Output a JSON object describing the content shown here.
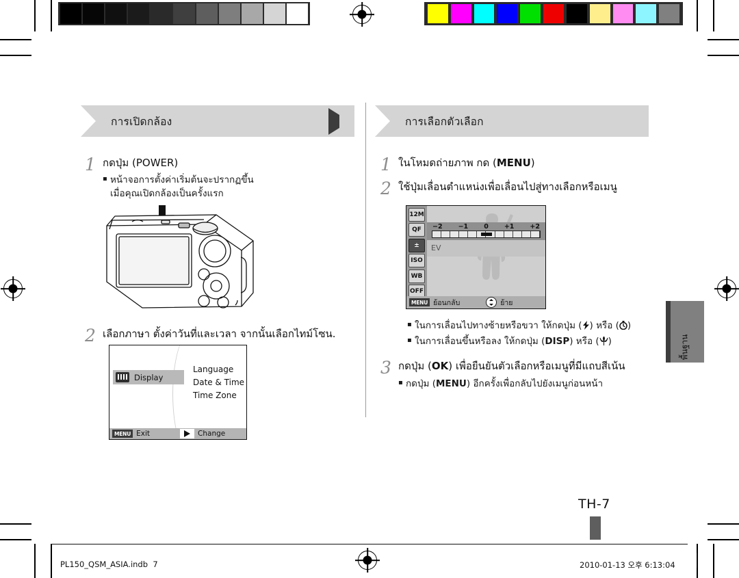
{
  "print_marks": {
    "gray_scale_swatches": [
      "#000000",
      "#060606",
      "#101010",
      "#1b1b1b",
      "#2a2a2a",
      "#3f3f3f",
      "#5e5e5e",
      "#7e7e7e",
      "#a8a8a8",
      "#d5d5d5",
      "#ffffff"
    ],
    "color_swatches": [
      "#ffff00",
      "#ff00ff",
      "#00ffff",
      "#0000ff",
      "#00e000",
      "#ee0000",
      "#000000",
      "#ffef8c",
      "#ff8cf0",
      "#8cf5ff",
      "#808080"
    ],
    "registration_icon": "registration-target-icon"
  },
  "left_column": {
    "ribbon": {
      "title": "การเปิดกล้อง",
      "marker_icon": "play-triangle-icon"
    },
    "step1": {
      "number": "1",
      "text": "กดปุ่ม (POWER)",
      "bullets": [
        "หน้าจอการตั้งค่าเริ่มต้นจะปรากฏขึ้น",
        "เมื่อคุณเปิดกล้องเป็นครั้งแรก"
      ]
    },
    "camera_figure": {
      "alt": "camera-back-illustration",
      "arrow_icon": "down-arrow-icon"
    },
    "step2": {
      "number": "2",
      "text": "เลือกภาษา ตั้งค่าวันที่และเวลา จากนั้นเลือกไทม์โซน."
    },
    "display_screen": {
      "selected_item": "Display",
      "selected_icon": "display-icon",
      "options": [
        "Language",
        "Date & Time",
        "Time Zone"
      ],
      "bottom_bar": {
        "back_key": "MENU",
        "back_label": "Exit",
        "action_icon": "right-triangle-icon",
        "action_label": "Change"
      }
    }
  },
  "right_column": {
    "ribbon": {
      "title": "การเลือกตัวเลือก",
      "marker_icon": "stop-square-icon"
    },
    "step1": {
      "number": "1",
      "text_before": "ในโหมดถ่ายภาพ กด (",
      "key": "MENU",
      "text_after": ")"
    },
    "step2": {
      "number": "2",
      "text": "ใช้ปุ่มเลื่อนตำแหน่งเพื่อเลื่อนไปสู่ทางเลือกหรือเมนู"
    },
    "lcd_screen": {
      "icons": [
        {
          "name": "resolution-icon",
          "label": "12M"
        },
        {
          "name": "quality-icon",
          "label": "QF"
        },
        {
          "name": "ev-icon",
          "label": "EV",
          "selected": true
        },
        {
          "name": "iso-icon",
          "label": "ISO"
        },
        {
          "name": "white-balance-icon",
          "label": "WB"
        },
        {
          "name": "face-detection-icon",
          "label": "OFF"
        },
        {
          "name": "photo-style-icon",
          "label": "OFF"
        }
      ],
      "ev_scale": [
        "−2",
        "−1",
        "0",
        "+1",
        "+2"
      ],
      "ev_value": "0",
      "ev_label": "EV",
      "bottom_bar": {
        "back_key": "MENU",
        "back_label": "ย้อนกลับ",
        "nav_icon": "four-way-dpad-icon",
        "nav_label": "ย้าย"
      }
    },
    "bullets": [
      {
        "before": "ในการเลื่อนไปทางซ้ายหรือขวา ให้กดปุ่ม (",
        "icon1": "flash-bolt-icon",
        "mid": ") หรือ (",
        "icon2": "self-timer-icon",
        "after": ")"
      },
      {
        "before": "ในการเลื่อนขึ้นหรือลง ให้กดปุ่ม (",
        "key": "DISP",
        "mid": ") หรือ (",
        "icon2": "macro-tulip-icon",
        "after": ")"
      }
    ],
    "step3": {
      "number": "3",
      "text_before": "กดปุ่ม (",
      "key": "OK",
      "text_after": ") เพื่อยืนยันตัวเลือกหรือเมนูที่มีแถบสีเน้น",
      "bullet_before": "กดปุ่ม (",
      "bullet_key": "MENU",
      "bullet_after": ") อีกครั้งเพื่อกลับไปยังเมนูก่อนหน้า"
    }
  },
  "side_tab": {
    "label": "พื้นฐาน"
  },
  "page_number": "TH-7",
  "footer": {
    "file_name": "PL150_QSM_ASIA.indb",
    "page": "7",
    "timestamp": "2010-01-13   오후 6:13:04"
  }
}
